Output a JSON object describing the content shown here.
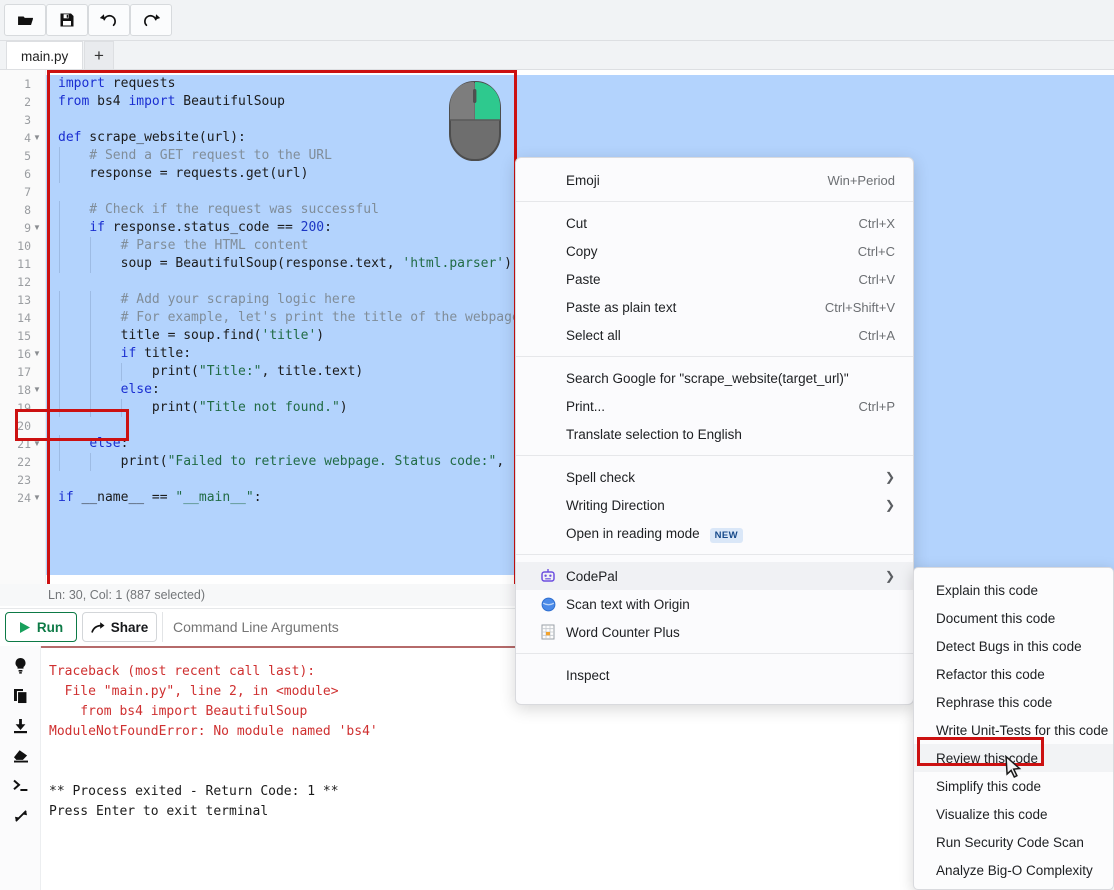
{
  "toolbar": {
    "buttons": [
      {
        "name": "open-file-button",
        "icon": "folder-open-icon",
        "label": ""
      },
      {
        "name": "save-file-button",
        "icon": "save-disk-icon",
        "label": ""
      },
      {
        "name": "undo-button",
        "icon": "undo-arrow-icon",
        "label": ""
      },
      {
        "name": "redo-button",
        "icon": "redo-arrow-icon",
        "label": ""
      }
    ]
  },
  "tabs": {
    "active_tab": "main.py",
    "add_tab_label": "+"
  },
  "editor": {
    "status_bar": "Ln: 30,  Col: 1 (887 selected)",
    "selection_color": "#b3d3fd",
    "highlight_box_color": "#cc1111",
    "lines": [
      {
        "n": "1",
        "fold": false,
        "text": "import requests"
      },
      {
        "n": "2",
        "fold": false,
        "text": "from bs4 import BeautifulSoup"
      },
      {
        "n": "3",
        "fold": false,
        "text": ""
      },
      {
        "n": "4",
        "fold": true,
        "text": "def scrape_website(url):"
      },
      {
        "n": "5",
        "fold": false,
        "text": "    # Send a GET request to the URL"
      },
      {
        "n": "6",
        "fold": false,
        "text": "    response = requests.get(url)"
      },
      {
        "n": "7",
        "fold": false,
        "text": ""
      },
      {
        "n": "8",
        "fold": false,
        "text": "    # Check if the request was successful"
      },
      {
        "n": "9",
        "fold": true,
        "text": "    if response.status_code == 200:"
      },
      {
        "n": "10",
        "fold": false,
        "text": "        # Parse the HTML content"
      },
      {
        "n": "11",
        "fold": false,
        "text": "        soup = BeautifulSoup(response.text, 'html.parser')"
      },
      {
        "n": "12",
        "fold": false,
        "text": ""
      },
      {
        "n": "13",
        "fold": false,
        "text": "        # Add your scraping logic here"
      },
      {
        "n": "14",
        "fold": false,
        "text": "        # For example, let's print the title of the webpage"
      },
      {
        "n": "15",
        "fold": false,
        "text": "        title = soup.find('title')"
      },
      {
        "n": "16",
        "fold": true,
        "text": "        if title:"
      },
      {
        "n": "17",
        "fold": false,
        "text": "            print(\"Title:\", title.text)"
      },
      {
        "n": "18",
        "fold": true,
        "text": "        else:"
      },
      {
        "n": "19",
        "fold": false,
        "text": "            print(\"Title not found.\")"
      },
      {
        "n": "20",
        "fold": false,
        "text": ""
      },
      {
        "n": "21",
        "fold": true,
        "text": "    else:"
      },
      {
        "n": "22",
        "fold": false,
        "text": "        print(\"Failed to retrieve webpage. Status code:\", re"
      },
      {
        "n": "23",
        "fold": false,
        "text": ""
      },
      {
        "n": "24",
        "fold": true,
        "text": "if __name__ == \"__main__\":"
      }
    ]
  },
  "runbar": {
    "run_label": "Run",
    "share_label": "Share",
    "cli_placeholder": "Command Line Arguments",
    "cli_value": "",
    "run_accent": "#0d7a46"
  },
  "terminal": {
    "rail_icons": [
      "lightbulb-icon",
      "copy-icon",
      "download-icon",
      "clear-eraser-icon",
      "terminal-prompt-icon",
      "expand-arrows-icon"
    ],
    "output": [
      {
        "text": "Traceback (most recent call last):",
        "error": true
      },
      {
        "text": "  File \"main.py\", line 2, in <module>",
        "error": true
      },
      {
        "text": "    from bs4 import BeautifulSoup",
        "error": true
      },
      {
        "text": "ModuleNotFoundError: No module named 'bs4'",
        "error": true
      },
      {
        "text": "",
        "error": false
      },
      {
        "text": "",
        "error": false
      },
      {
        "text": "** Process exited - Return Code: 1 **",
        "error": false
      },
      {
        "text": "Press Enter to exit terminal",
        "error": false
      }
    ]
  },
  "context_menu": {
    "groups": [
      {
        "items": [
          {
            "label": "Emoji",
            "shortcut": "Win+Period",
            "icon": "",
            "arrow": false,
            "badge": ""
          }
        ]
      },
      {
        "items": [
          {
            "label": "Cut",
            "shortcut": "Ctrl+X",
            "icon": "",
            "arrow": false,
            "badge": ""
          },
          {
            "label": "Copy",
            "shortcut": "Ctrl+C",
            "icon": "",
            "arrow": false,
            "badge": ""
          },
          {
            "label": "Paste",
            "shortcut": "Ctrl+V",
            "icon": "",
            "arrow": false,
            "badge": ""
          },
          {
            "label": "Paste as plain text",
            "shortcut": "Ctrl+Shift+V",
            "icon": "",
            "arrow": false,
            "badge": ""
          },
          {
            "label": "Select all",
            "shortcut": "Ctrl+A",
            "icon": "",
            "arrow": false,
            "badge": ""
          }
        ]
      },
      {
        "items": [
          {
            "label": "Search Google for \"scrape_website(target_url)\"",
            "shortcut": "",
            "icon": "",
            "arrow": false,
            "badge": ""
          },
          {
            "label": "Print...",
            "shortcut": "Ctrl+P",
            "icon": "",
            "arrow": false,
            "badge": ""
          },
          {
            "label": "Translate selection to English",
            "shortcut": "",
            "icon": "",
            "arrow": false,
            "badge": ""
          }
        ]
      },
      {
        "items": [
          {
            "label": "Spell check",
            "shortcut": "",
            "icon": "",
            "arrow": true,
            "badge": ""
          },
          {
            "label": "Writing Direction",
            "shortcut": "",
            "icon": "",
            "arrow": true,
            "badge": ""
          },
          {
            "label": "Open in reading mode",
            "shortcut": "",
            "icon": "",
            "arrow": false,
            "badge": "NEW"
          }
        ]
      },
      {
        "items": [
          {
            "label": "CodePal",
            "shortcut": "",
            "icon": "codepal-robot-icon",
            "arrow": true,
            "badge": ""
          },
          {
            "label": "Scan text with Origin",
            "shortcut": "",
            "icon": "origin-circle-icon",
            "arrow": false,
            "badge": ""
          },
          {
            "label": "Word Counter Plus",
            "shortcut": "",
            "icon": "word-counter-grid-icon",
            "arrow": false,
            "badge": ""
          }
        ]
      },
      {
        "items": [
          {
            "label": "Inspect",
            "shortcut": "",
            "icon": "",
            "arrow": false,
            "badge": ""
          }
        ]
      }
    ]
  },
  "submenu": {
    "items": [
      {
        "label": "Explain this code"
      },
      {
        "label": "Document this code"
      },
      {
        "label": "Detect Bugs in this code"
      },
      {
        "label": "Refactor this code"
      },
      {
        "label": "Rephrase this code"
      },
      {
        "label": "Write Unit-Tests for this code"
      },
      {
        "label": "Review this code"
      },
      {
        "label": "Simplify this code"
      },
      {
        "label": "Visualize this code"
      },
      {
        "label": "Run Security Code Scan"
      },
      {
        "label": "Analyze Big-O Complexity"
      }
    ],
    "highlighted": "Review this code"
  }
}
